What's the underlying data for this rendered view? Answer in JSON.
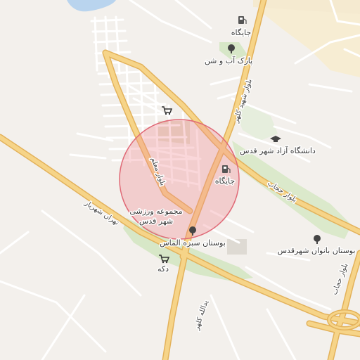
{
  "map": {
    "labels": {
      "gas_station_north": "جایگاه",
      "water_park": "پارک آب و شن",
      "university": "دانشگاه آزاد شهر قدس",
      "gas_station_center": "جایگاه",
      "sports_complex_line1": "مجموعه ورزشی",
      "sports_complex_line2": "شهر قدس",
      "almas_park": "بوستان سبزه الماس",
      "women_park": "بوستان بانوان شهرقدس",
      "shop": "دکه"
    },
    "roads": {
      "tehran_shahriar": "تهران شهریار",
      "moallem_blvd": "بلوار معلم",
      "shahid_kalhor": "بلوار شهید کلهر",
      "hejab_blvd": "بلوار حجاب",
      "hejab_blvd_east": "بلوار حجاب",
      "yadollah_kalhor": "یدالله کلهر"
    },
    "icons": {
      "gas": "fuel-pump-icon",
      "park": "tree-icon",
      "university": "graduation-cap-icon",
      "shop": "shopping-cart-icon"
    },
    "colors": {
      "background": "#f3f0ec",
      "major_road": "#f6d488",
      "major_road_edge": "#e3b25b",
      "minor_road": "#ffffff",
      "park": "#d7e7c7",
      "water": "#b9d4ee",
      "highlight_circle": "#f08d96"
    }
  }
}
